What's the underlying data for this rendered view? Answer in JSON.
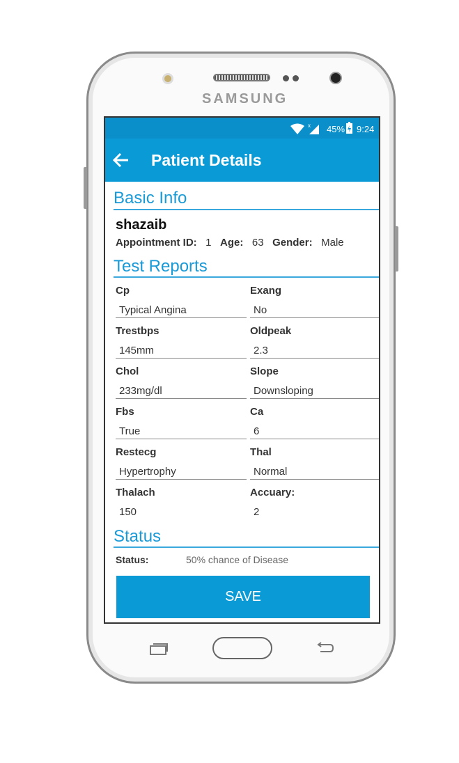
{
  "device": {
    "brand": "SAMSUNG"
  },
  "status_bar": {
    "battery": "45%",
    "time": "9:24"
  },
  "app_bar": {
    "title": "Patient Details"
  },
  "basic_info": {
    "heading": "Basic Info",
    "name": "shazaib",
    "appointment_label": "Appointment ID:",
    "appointment_value": "1",
    "age_label": "Age:",
    "age_value": "63",
    "gender_label": "Gender:",
    "gender_value": "Male"
  },
  "test_reports": {
    "heading": "Test Reports",
    "fields": [
      {
        "label": "Cp",
        "value": "Typical Angina"
      },
      {
        "label": "Exang",
        "value": "No"
      },
      {
        "label": "Trestbps",
        "value": "145mm"
      },
      {
        "label": "Oldpeak",
        "value": "2.3"
      },
      {
        "label": "Chol",
        "value": "233mg/dl"
      },
      {
        "label": "Slope",
        "value": "Downsloping"
      },
      {
        "label": "Fbs",
        "value": "True"
      },
      {
        "label": "Ca",
        "value": "6"
      },
      {
        "label": "Restecg",
        "value": "Hypertrophy"
      },
      {
        "label": "Thal",
        "value": "Normal"
      },
      {
        "label": "Thalach",
        "value": "150"
      },
      {
        "label": "Accuary:",
        "value": "2"
      }
    ]
  },
  "status": {
    "heading": "Status",
    "label": "Status:",
    "value": "50% chance of Disease"
  },
  "save_label": "SAVE",
  "colors": {
    "primary": "#0a9ad6",
    "status_bar": "#0a8fca",
    "heading": "#1a9ad6"
  }
}
